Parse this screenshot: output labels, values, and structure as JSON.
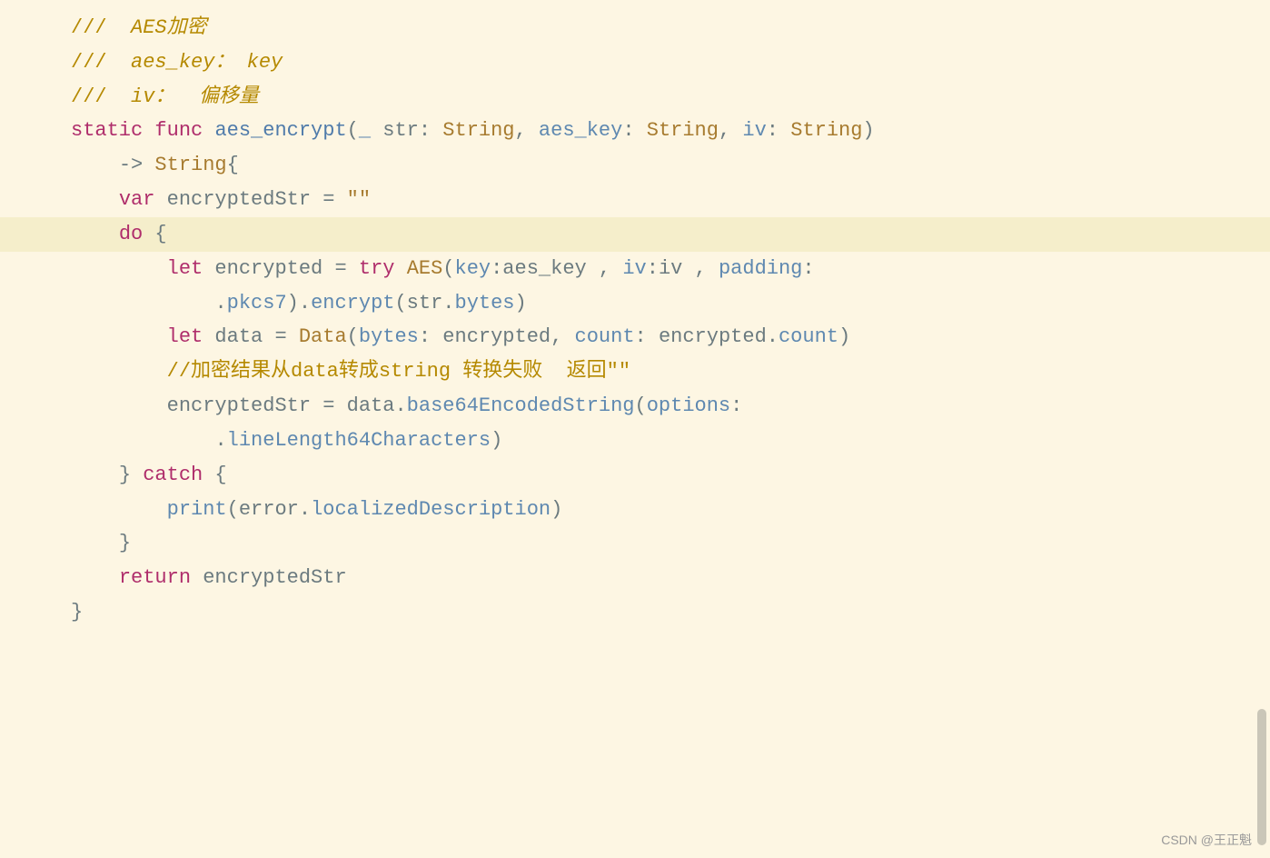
{
  "code": {
    "lines": [
      {
        "indent": "",
        "segments": [
          {
            "cls": "comment-slash",
            "text": "/// "
          },
          {
            "cls": "comment",
            "text": " AES加密"
          }
        ]
      },
      {
        "indent": "",
        "segments": [
          {
            "cls": "comment-slash",
            "text": "/// "
          },
          {
            "cls": "comment-key",
            "text": " aes_key： key"
          }
        ]
      },
      {
        "indent": "",
        "segments": [
          {
            "cls": "comment-slash",
            "text": "/// "
          },
          {
            "cls": "comment-key",
            "text": " iv："
          },
          {
            "cls": "comment",
            "text": "  偏移量"
          }
        ]
      },
      {
        "indent": "",
        "segments": [
          {
            "cls": "keyword",
            "text": "static"
          },
          {
            "cls": "plain",
            "text": " "
          },
          {
            "cls": "keyword",
            "text": "func"
          },
          {
            "cls": "plain",
            "text": " "
          },
          {
            "cls": "func-name",
            "text": "aes_encrypt"
          },
          {
            "cls": "plain",
            "text": "("
          },
          {
            "cls": "param",
            "text": "_"
          },
          {
            "cls": "plain",
            "text": " str: "
          },
          {
            "cls": "type",
            "text": "String"
          },
          {
            "cls": "plain",
            "text": ", "
          },
          {
            "cls": "param",
            "text": "aes_key"
          },
          {
            "cls": "plain",
            "text": ": "
          },
          {
            "cls": "type",
            "text": "String"
          },
          {
            "cls": "plain",
            "text": ", "
          },
          {
            "cls": "param",
            "text": "iv"
          },
          {
            "cls": "plain",
            "text": ": "
          },
          {
            "cls": "type",
            "text": "String"
          },
          {
            "cls": "plain",
            "text": ")"
          }
        ]
      },
      {
        "indent": "    ",
        "segments": [
          {
            "cls": "plain",
            "text": "-> "
          },
          {
            "cls": "type",
            "text": "String"
          },
          {
            "cls": "plain",
            "text": "{"
          }
        ]
      },
      {
        "indent": "    ",
        "segments": [
          {
            "cls": "keyword",
            "text": "var"
          },
          {
            "cls": "plain",
            "text": " encryptedStr = "
          },
          {
            "cls": "string",
            "text": "\"\""
          }
        ]
      },
      {
        "indent": "    ",
        "highlighted": true,
        "segments": [
          {
            "cls": "keyword",
            "text": "do"
          },
          {
            "cls": "plain",
            "text": " {"
          }
        ]
      },
      {
        "indent": "        ",
        "segments": [
          {
            "cls": "keyword",
            "text": "let"
          },
          {
            "cls": "plain",
            "text": " encrypted = "
          },
          {
            "cls": "keyword",
            "text": "try"
          },
          {
            "cls": "plain",
            "text": " "
          },
          {
            "cls": "type",
            "text": "AES"
          },
          {
            "cls": "plain",
            "text": "("
          },
          {
            "cls": "param",
            "text": "key"
          },
          {
            "cls": "plain",
            "text": ":aes_key , "
          },
          {
            "cls": "param",
            "text": "iv"
          },
          {
            "cls": "plain",
            "text": ":iv , "
          },
          {
            "cls": "param",
            "text": "padding"
          },
          {
            "cls": "plain",
            "text": ":"
          }
        ]
      },
      {
        "indent": "            ",
        "segments": [
          {
            "cls": "plain",
            "text": "."
          },
          {
            "cls": "method",
            "text": "pkcs7"
          },
          {
            "cls": "plain",
            "text": ")."
          },
          {
            "cls": "method",
            "text": "encrypt"
          },
          {
            "cls": "plain",
            "text": "(str."
          },
          {
            "cls": "method",
            "text": "bytes"
          },
          {
            "cls": "plain",
            "text": ")"
          }
        ]
      },
      {
        "indent": "",
        "segments": [
          {
            "cls": "plain",
            "text": ""
          }
        ]
      },
      {
        "indent": "        ",
        "segments": [
          {
            "cls": "keyword",
            "text": "let"
          },
          {
            "cls": "plain",
            "text": " data = "
          },
          {
            "cls": "type",
            "text": "Data"
          },
          {
            "cls": "plain",
            "text": "("
          },
          {
            "cls": "param",
            "text": "bytes"
          },
          {
            "cls": "plain",
            "text": ": encrypted, "
          },
          {
            "cls": "param",
            "text": "count"
          },
          {
            "cls": "plain",
            "text": ": encrypted."
          },
          {
            "cls": "method",
            "text": "count"
          },
          {
            "cls": "plain",
            "text": ")"
          }
        ]
      },
      {
        "indent": "",
        "segments": [
          {
            "cls": "plain",
            "text": ""
          }
        ]
      },
      {
        "indent": "        ",
        "segments": [
          {
            "cls": "comment-slash",
            "text": "//加密结果从data转成string 转换失败  返回\"\""
          }
        ]
      },
      {
        "indent": "        ",
        "segments": [
          {
            "cls": "plain",
            "text": "encryptedStr = data."
          },
          {
            "cls": "method",
            "text": "base64EncodedString"
          },
          {
            "cls": "plain",
            "text": "("
          },
          {
            "cls": "param",
            "text": "options"
          },
          {
            "cls": "plain",
            "text": ":"
          }
        ]
      },
      {
        "indent": "            ",
        "segments": [
          {
            "cls": "plain",
            "text": "."
          },
          {
            "cls": "method",
            "text": "lineLength64Characters"
          },
          {
            "cls": "plain",
            "text": ")"
          }
        ]
      },
      {
        "indent": "",
        "segments": [
          {
            "cls": "plain",
            "text": ""
          }
        ]
      },
      {
        "indent": "    ",
        "segments": [
          {
            "cls": "plain",
            "text": "} "
          },
          {
            "cls": "keyword",
            "text": "catch"
          },
          {
            "cls": "plain",
            "text": " {"
          }
        ]
      },
      {
        "indent": "        ",
        "segments": [
          {
            "cls": "method",
            "text": "print"
          },
          {
            "cls": "plain",
            "text": "(error."
          },
          {
            "cls": "method",
            "text": "localizedDescription"
          },
          {
            "cls": "plain",
            "text": ")"
          }
        ]
      },
      {
        "indent": "    ",
        "segments": [
          {
            "cls": "plain",
            "text": "}"
          }
        ]
      },
      {
        "indent": "    ",
        "segments": [
          {
            "cls": "keyword",
            "text": "return"
          },
          {
            "cls": "plain",
            "text": " encryptedStr"
          }
        ]
      },
      {
        "indent": "",
        "segments": [
          {
            "cls": "plain",
            "text": ""
          }
        ]
      },
      {
        "indent": "",
        "segments": [
          {
            "cls": "plain",
            "text": "}"
          }
        ]
      }
    ]
  },
  "watermark": "CSDN @王正魁"
}
